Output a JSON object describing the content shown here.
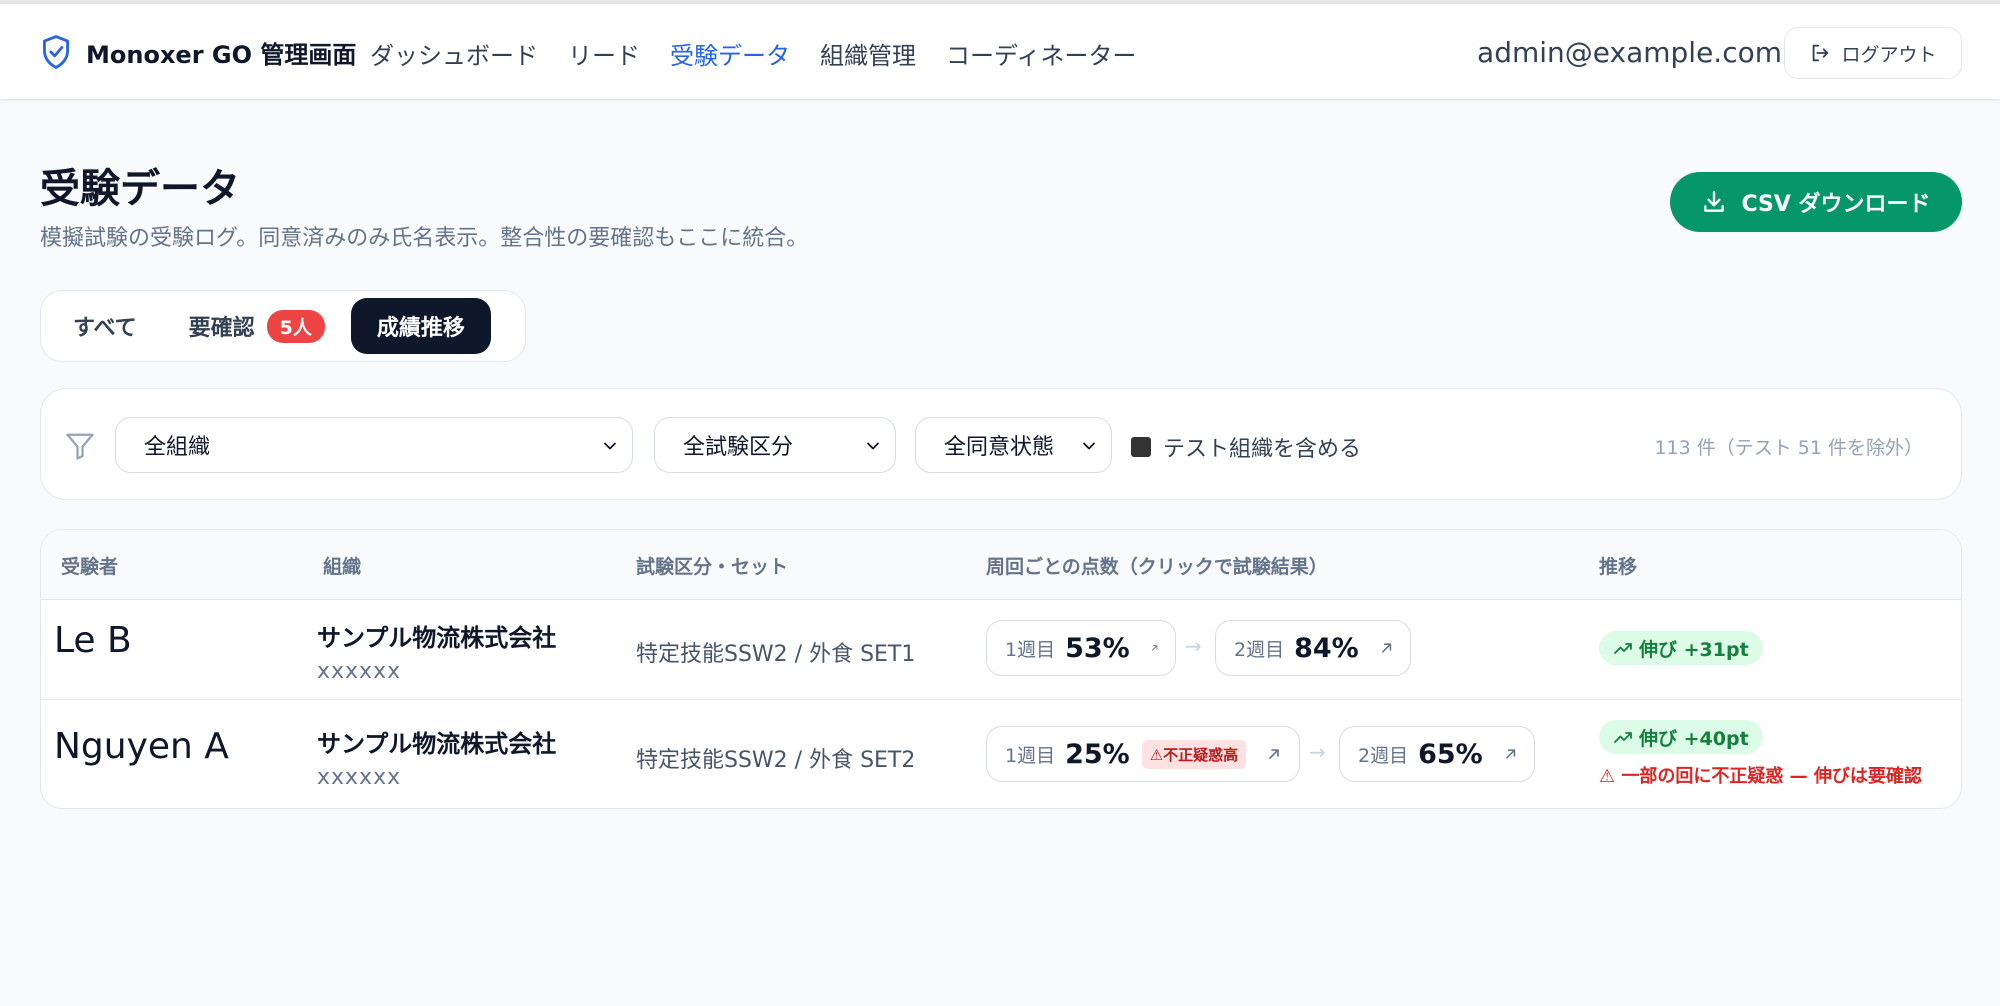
{
  "app": {
    "title": "Monoxer GO 管理画面",
    "icon": "shield-check-icon"
  },
  "nav": {
    "items": [
      {
        "label": "ダッシュボード"
      },
      {
        "label": "リード"
      },
      {
        "label": "受験データ",
        "active": true
      },
      {
        "label": "組織管理"
      },
      {
        "label": "コーディネーター"
      }
    ]
  },
  "user": {
    "email": "admin@example.com",
    "logout_label": "ログアウト"
  },
  "page": {
    "title": "受験データ",
    "subtitle": "模擬試験の受験ログ。同意済みのみ氏名表示。整合性の要確認もここに統合。",
    "csv_button_label": "CSV ダウンロード"
  },
  "tabs": {
    "all_label": "すべて",
    "review_label": "要確認",
    "review_count": "5人",
    "trend_label": "成績推移",
    "active": "trend"
  },
  "filters": {
    "organization": "全組織",
    "exam_category": "全試験区分",
    "consent": "全同意状態",
    "include_test_label": "テスト組織を含める",
    "include_test_checked": true,
    "result_count": "113 件（テスト 51 件を除外）"
  },
  "table": {
    "headers": {
      "examinee": "受験者",
      "organization": "組織",
      "exam": "試験区分・セット",
      "scores": "周回ごとの点数（クリックで試験結果）",
      "trend": "推移"
    },
    "rows": [
      {
        "name": "Le B",
        "org_name": "サンプル物流株式会社",
        "org_sub": "xxxxxx",
        "exam": "特定技能SSW2 / 外食 SET1",
        "attempts": [
          {
            "label": "1週目",
            "score": "53%"
          },
          {
            "label": "2週目",
            "score": "84%"
          }
        ],
        "trend": "伸び +31pt"
      },
      {
        "name": "Nguyen A",
        "org_name": "サンプル物流株式会社",
        "org_sub": "xxxxxx",
        "exam": "特定技能SSW2 / 外食 SET2",
        "attempts": [
          {
            "label": "1週目",
            "score": "25%",
            "flag": "⚠不正疑惑高"
          },
          {
            "label": "2週目",
            "score": "65%"
          }
        ],
        "trend": "伸び +40pt",
        "warning": "⚠ 一部の回に不正疑惑 — 伸びは要確認"
      }
    ]
  },
  "colors": {
    "accent": "#2563eb",
    "csv_button": "#059669",
    "tab_active": "#0f172a",
    "badge_red": "#ef4444",
    "trend_bg": "#dcfce7",
    "trend_text": "#15803d",
    "warning": "#dc2626"
  }
}
